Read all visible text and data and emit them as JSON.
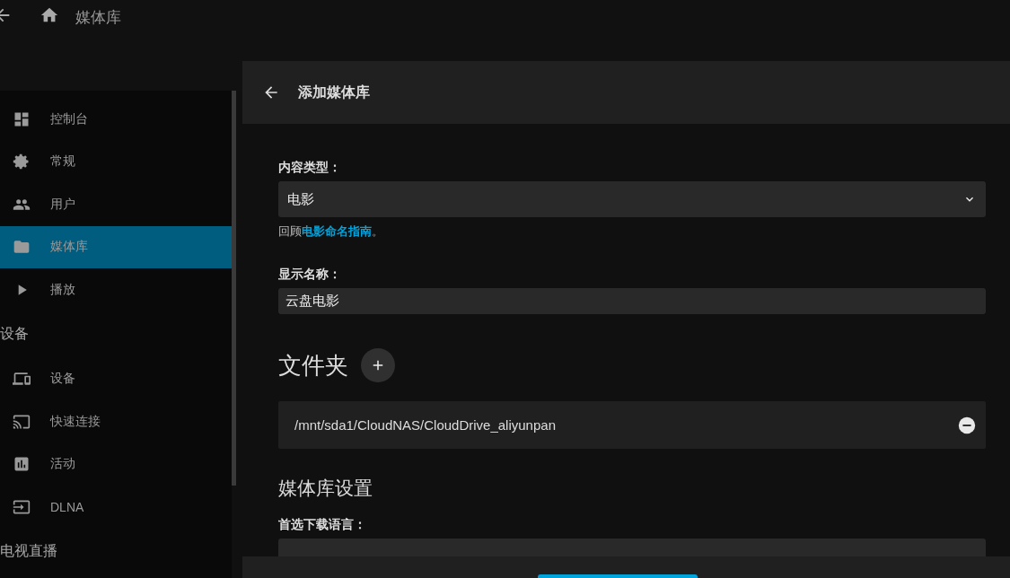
{
  "header": {
    "title": "媒体库"
  },
  "sidebar": {
    "items": [
      {
        "kind": "link",
        "label": "控制台",
        "selected": false
      },
      {
        "kind": "link",
        "label": "常规",
        "selected": false
      },
      {
        "kind": "link",
        "label": "用户",
        "selected": false
      },
      {
        "kind": "link",
        "label": "媒体库",
        "selected": true
      },
      {
        "kind": "link",
        "label": "播放",
        "selected": false
      },
      {
        "kind": "heading",
        "label": "设备"
      },
      {
        "kind": "link",
        "label": "设备",
        "selected": false
      },
      {
        "kind": "link",
        "label": "快速连接",
        "selected": false
      },
      {
        "kind": "link",
        "label": "活动",
        "selected": false
      },
      {
        "kind": "link",
        "label": "DLNA",
        "selected": false
      },
      {
        "kind": "heading",
        "label": "电视直播"
      }
    ]
  },
  "dialog": {
    "title": "添加媒体库",
    "content_type": {
      "label": "内容类型：",
      "value": "电影",
      "hint_before": "回顾",
      "hint_link": "电影命名指南",
      "hint_after": "。"
    },
    "display_name": {
      "label": "显示名称：",
      "value": "云盘电影"
    },
    "folders": {
      "heading": "文件夹",
      "items": [
        "/mnt/sda1/CloudNAS/CloudDrive_aliyunpan"
      ]
    },
    "settings": {
      "heading": "媒体库设置",
      "language_label": "首选下载语言："
    }
  }
}
